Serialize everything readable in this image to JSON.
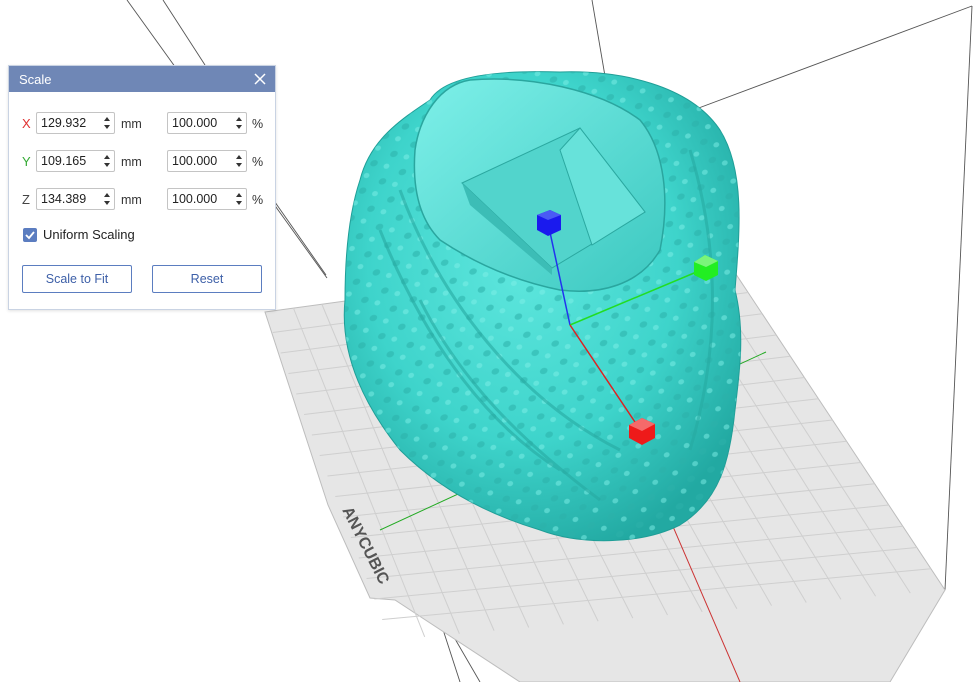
{
  "panel": {
    "title": "Scale",
    "axes": [
      {
        "label": "X",
        "color": "#e03030",
        "size_mm": "129.932",
        "percent": "100.000"
      },
      {
        "label": "Y",
        "color": "#33aa33",
        "size_mm": "109.165",
        "percent": "100.000"
      },
      {
        "label": "Z",
        "color": "#444444",
        "size_mm": "134.389",
        "percent": "100.000"
      }
    ],
    "mm_unit": "mm",
    "percent_unit": "%",
    "uniform_scaling_label": "Uniform Scaling",
    "uniform_scaling_checked": true,
    "scale_to_fit_label": "Scale to Fit",
    "reset_label": "Reset"
  },
  "viewport": {
    "plate_logo": "ANYCUBIC",
    "model_color": "#40d8cf",
    "gizmo_colors": {
      "x": "#ff1a1a",
      "y": "#22ee22",
      "z": "#1a1aee"
    }
  }
}
